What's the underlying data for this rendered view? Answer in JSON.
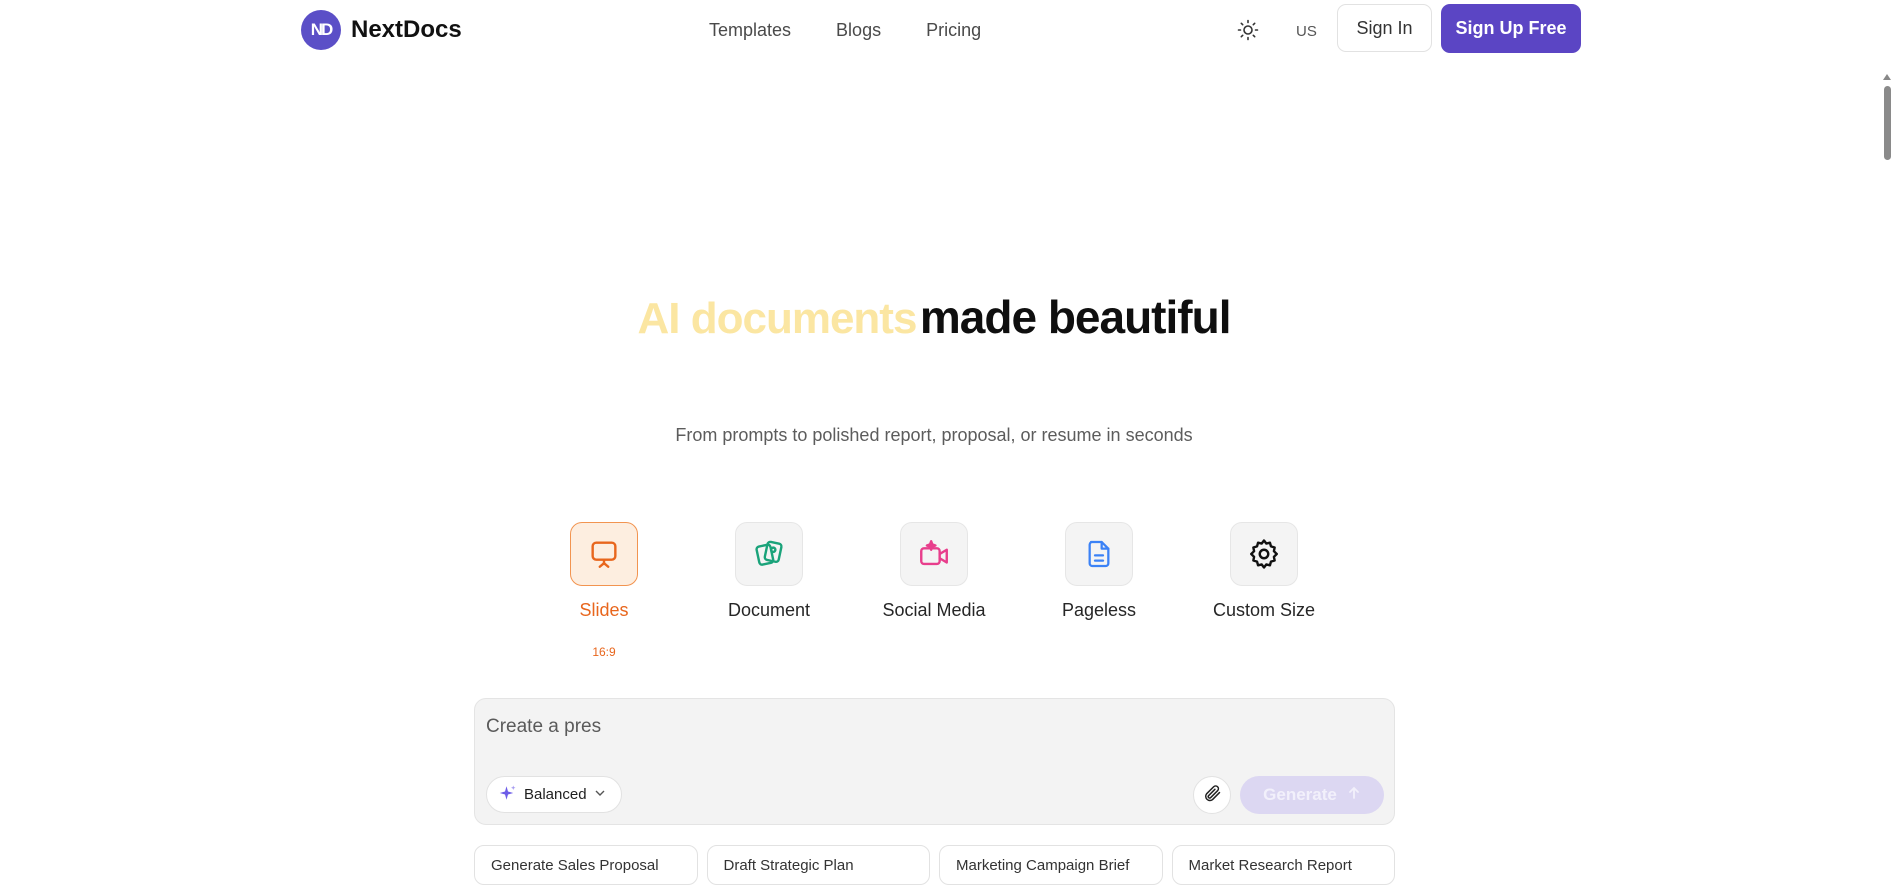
{
  "brand": {
    "logo_mark": "ND",
    "name": "NextDocs",
    "color": "#5b45c4"
  },
  "nav": {
    "items": [
      "Templates",
      "Blogs",
      "Pricing"
    ]
  },
  "header": {
    "theme_icon": "sun-icon",
    "locale": "US",
    "signin_label": "Sign In",
    "signup_label": "Sign Up Free"
  },
  "hero": {
    "title_part1": "AI documents",
    "title_part2": "made beautiful",
    "subtitle": "From prompts to polished report, proposal, or resume in seconds"
  },
  "types": {
    "items": [
      {
        "label": "Slides",
        "icon": "presentation-icon",
        "color": "#e8661d",
        "active": true
      },
      {
        "label": "Document",
        "icon": "document-cards-icon",
        "color": "#1aa37a"
      },
      {
        "label": "Social Media",
        "icon": "video-sparkle-icon",
        "color": "#e83e8c"
      },
      {
        "label": "Pageless",
        "icon": "file-text-icon",
        "color": "#3b82f6"
      },
      {
        "label": "Custom Size",
        "icon": "gear-icon",
        "color": "#111111"
      }
    ],
    "selected_ratio": "16:9"
  },
  "prompt": {
    "value": "Create a pres",
    "mode_label": "Balanced",
    "generate_label": "Generate"
  },
  "suggestions": [
    "Generate Sales Proposal",
    "Draft Strategic Plan",
    "Marketing Campaign Brief",
    "Market Research Report"
  ]
}
